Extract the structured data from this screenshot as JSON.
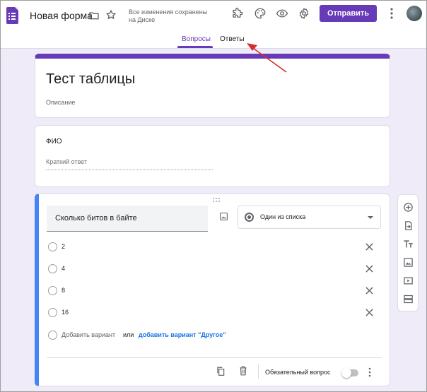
{
  "header": {
    "form_title": "Новая форма",
    "save_status_line1": "Все изменения сохранены",
    "save_status_line2": "на Диске",
    "send_label": "Отправить",
    "icons": [
      "addons-icon",
      "palette-icon",
      "preview-icon",
      "settings-icon",
      "more-vert-icon"
    ]
  },
  "tabs": {
    "questions": "Вопросы",
    "answers": "Ответы",
    "active": "questions"
  },
  "title_card": {
    "title": "Тест таблицы",
    "description": "Описание"
  },
  "fio_card": {
    "label": "ФИО",
    "placeholder": "Краткий ответ"
  },
  "question_card": {
    "question": "Сколько битов в байте",
    "type": "Один из списка",
    "options": [
      "2",
      "4",
      "8",
      "16"
    ],
    "add_option": "Добавить вариант",
    "or": "или",
    "add_other": "добавить вариант \"Другое\"",
    "required_label": "Обязательный вопрос",
    "required": false
  },
  "colors": {
    "accent": "#673ab7",
    "background": "#f0ebf8",
    "active_question_bar": "#4285f4",
    "link": "#1a73e8",
    "annotation_arrow": "#d32f2f"
  }
}
